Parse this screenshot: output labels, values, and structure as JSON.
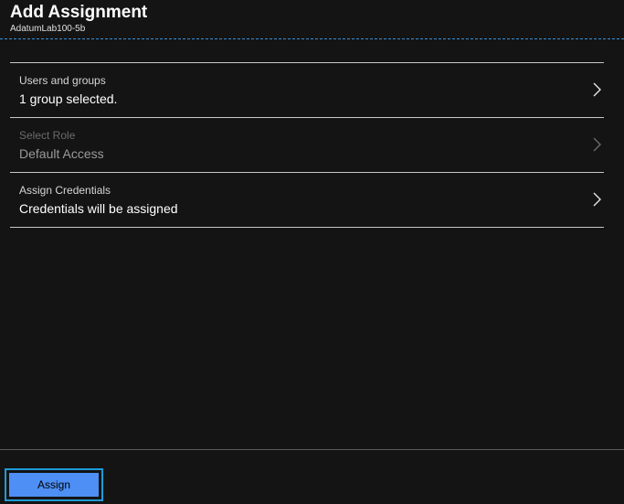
{
  "header": {
    "title": "Add Assignment",
    "subtitle": "AdatumLab100-5b"
  },
  "rows": [
    {
      "label": "Users and groups",
      "value": "1 group selected.",
      "disabled": false,
      "icon": "chevron-right-icon"
    },
    {
      "label": "Select Role",
      "value": "Default Access",
      "disabled": true,
      "icon": "chevron-right-icon"
    },
    {
      "label": "Assign Credentials",
      "value": "Credentials will be assigned",
      "disabled": false,
      "icon": "chevron-right-icon"
    }
  ],
  "footer": {
    "assign_label": "Assign"
  },
  "colors": {
    "background": "#141414",
    "accent": "#4d8ff5",
    "focus_outline": "#1e9bd7"
  }
}
